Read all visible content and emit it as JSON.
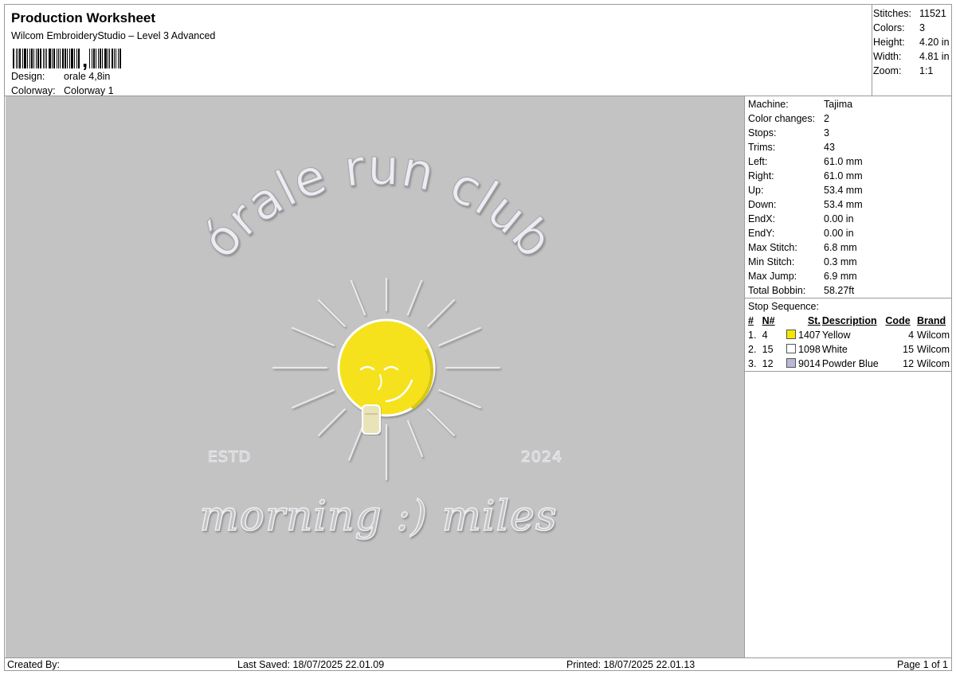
{
  "header": {
    "title": "Production Worksheet",
    "software": "Wilcom EmbroideryStudio – Level 3 Advanced",
    "design_label": "Design:",
    "design_value": "orale 4,8in",
    "colorway_label": "Colorway:",
    "colorway_value": "Colorway 1"
  },
  "summary": [
    {
      "label": "Stitches:",
      "value": "11521"
    },
    {
      "label": "Colors:",
      "value": "3"
    },
    {
      "label": "Height:",
      "value": "4.20 in"
    },
    {
      "label": "Width:",
      "value": "4.81 in"
    },
    {
      "label": "Zoom:",
      "value": "1:1"
    }
  ],
  "machine_info": [
    {
      "label": "Machine:",
      "value": "Tajima"
    },
    {
      "label": "Color changes:",
      "value": "2"
    },
    {
      "label": "Stops:",
      "value": "3"
    },
    {
      "label": "Trims:",
      "value": "43"
    },
    {
      "label": "Left:",
      "value": "61.0 mm"
    },
    {
      "label": "Right:",
      "value": "61.0 mm"
    },
    {
      "label": "Up:",
      "value": "53.4 mm"
    },
    {
      "label": "Down:",
      "value": "53.4 mm"
    },
    {
      "label": "EndX:",
      "value": "0.00 in"
    },
    {
      "label": "EndY:",
      "value": "0.00 in"
    },
    {
      "label": "Max Stitch:",
      "value": "6.8 mm"
    },
    {
      "label": "Min Stitch:",
      "value": "0.3 mm"
    },
    {
      "label": "Max Jump:",
      "value": "6.9 mm"
    },
    {
      "label": "Total Bobbin:",
      "value": "58.27ft"
    }
  ],
  "stop_sequence": {
    "title": "Stop Sequence:",
    "columns": [
      "#",
      "N#",
      "St.",
      "Description",
      "Code",
      "Brand"
    ],
    "rows": [
      {
        "idx": "1.",
        "n": "4",
        "color": "#f5e600",
        "st": "1407",
        "desc": "Yellow",
        "code": "4",
        "brand": "Wilcom"
      },
      {
        "idx": "2.",
        "n": "15",
        "color": "#ffffff",
        "st": "1098",
        "desc": "White",
        "code": "15",
        "brand": "Wilcom"
      },
      {
        "idx": "3.",
        "n": "12",
        "color": "#b8b9d6",
        "st": "9014",
        "desc": "Powder Blue",
        "code": "12",
        "brand": "Wilcom"
      }
    ]
  },
  "design": {
    "arc_text": "órale run club",
    "left_text": "ESTD",
    "right_text": "2024",
    "script_text": "morning :) miles",
    "sun_color": "#f5e21a",
    "thread_color": "#e4e4ec",
    "background": "#c3c3c3"
  },
  "footer": {
    "created_by": "Created By:",
    "last_saved": "Last Saved: 18/07/2025 22.01.09",
    "printed": "Printed: 18/07/2025 22.01.13",
    "page": "Page 1 of 1"
  }
}
